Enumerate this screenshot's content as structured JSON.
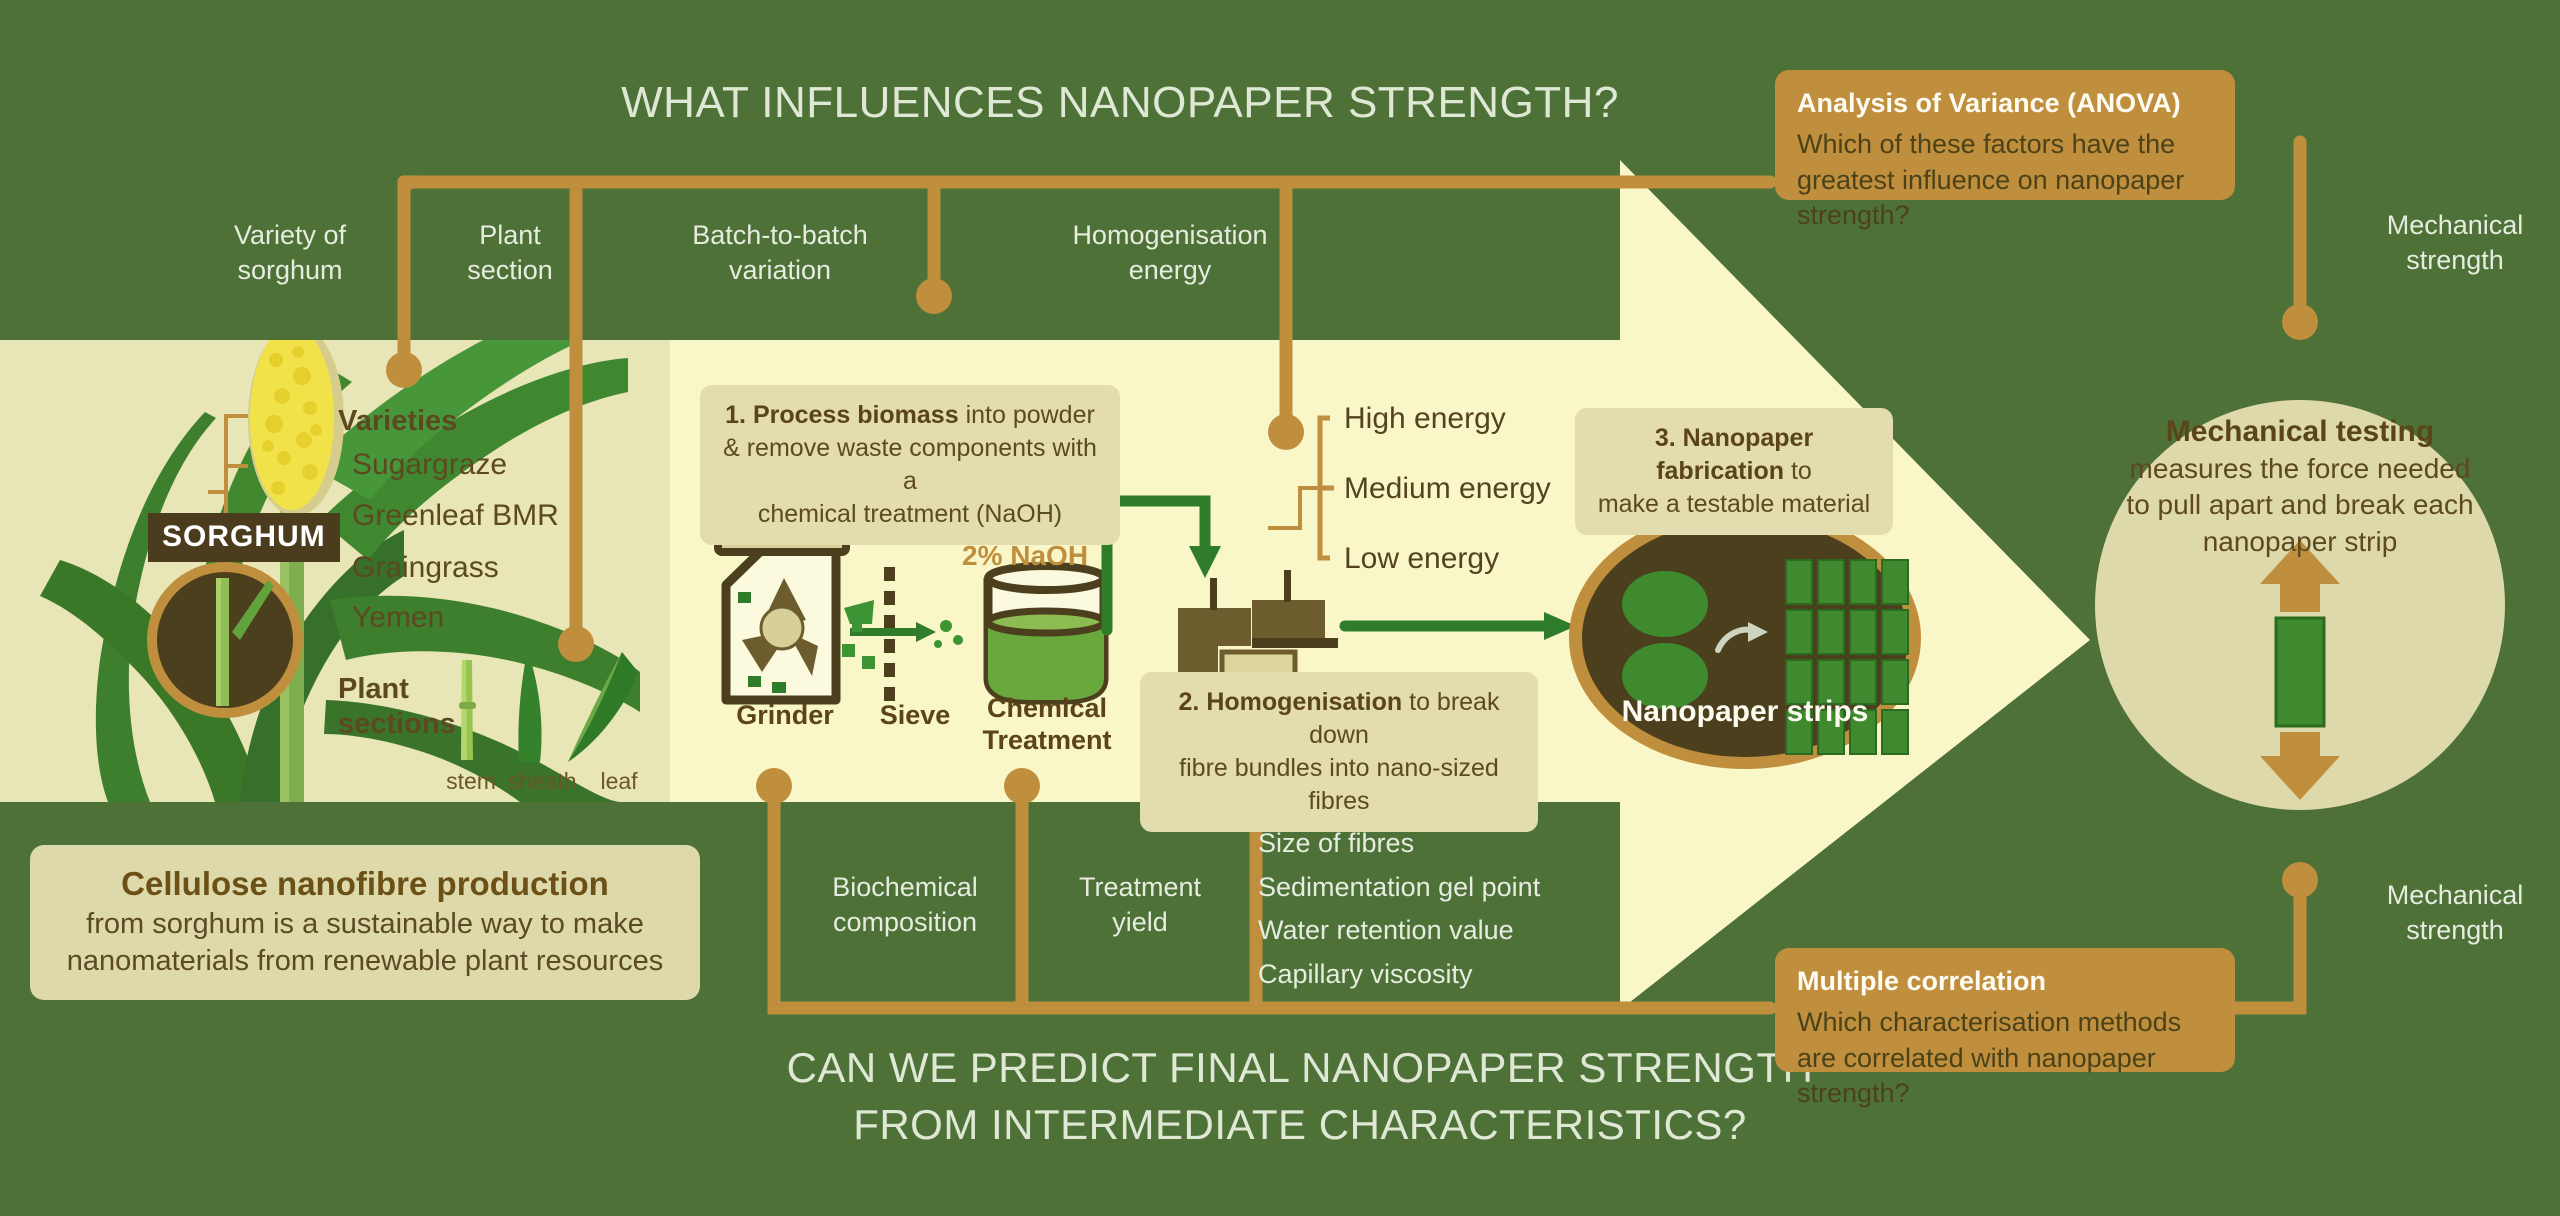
{
  "colors": {
    "bg_green": "#4e7138",
    "panel_cream": "#f7f5c4",
    "panel_khaki": "#e6e3b4",
    "connector": "#c08f3e",
    "card_brown": "#c08f3e",
    "card_khaki": "#ded9ab",
    "text_cream": "#dfe8d4",
    "text_brown": "#5c4920",
    "dark_brown": "#4a3c1c",
    "leaf_green": "#3f8a2e",
    "mid_green": "#2f7d2a"
  },
  "headline": {
    "top": "WHAT INFLUENCES NANOPAPER STRENGTH?",
    "bottom_line1": "CAN WE PREDICT FINAL NANOPAPER STRENGTH",
    "bottom_line2": "FROM INTERMEDIATE CHARACTERISTICS?"
  },
  "top_factors": [
    {
      "line1": "Variety of",
      "line2": "sorghum"
    },
    {
      "line1": "Plant",
      "line2": "section"
    },
    {
      "line1": "Batch-to-batch",
      "line2": "variation"
    },
    {
      "line1": "Homogenisation",
      "line2": "energy"
    }
  ],
  "anova": {
    "title": "Analysis of Variance (ANOVA)",
    "body": "Which of these factors have the greatest influence on nanopaper strength?"
  },
  "correlation": {
    "title": "Multiple correlation",
    "body": "Which characterisation methods are correlated with nanopaper strength?"
  },
  "mechanical_strength_top": {
    "line1": "Mechanical",
    "line2": "strength"
  },
  "mechanical_strength_bottom": {
    "line1": "Mechanical",
    "line2": "strength"
  },
  "summary_card": {
    "title": "Cellulose nanofibre production",
    "line1": "from sorghum is a sustainable way to make",
    "line2": "nanomaterials from renewable plant resources"
  },
  "sorghum_panel": {
    "tag": "SORGHUM",
    "varieties_heading": "Varieties",
    "varieties": [
      "Sugargraze",
      "Greenleaf BMR",
      "Graingrass",
      "Yemen"
    ],
    "sections_heading_line1": "Plant",
    "sections_heading_line2": "sections",
    "sections": [
      "stem",
      "sheath",
      "leaf"
    ]
  },
  "steps": {
    "step1_bold": "1. Process biomass",
    "step1_rest": " into powder",
    "step1_line2": "& remove waste components with a",
    "step1_line3": "chemical treatment (NaOH)",
    "step2_bold": "2. Homogenisation",
    "step2_rest": " to break down",
    "step2_line2": "fibre bundles into nano-sized fibres",
    "step3_bold": "3. Nanopaper fabrication",
    "step3_rest": " to",
    "step3_line2": "make a testable material"
  },
  "process_icons": {
    "grinder": "Grinder",
    "sieve": "Sieve",
    "chemical_line1": "Chemical",
    "chemical_line2": "Treatment",
    "naoh": "2% NaOH"
  },
  "energy_levels": [
    "High energy",
    "Medium energy",
    "Low energy"
  ],
  "nanopaper_label": "Nanopaper strips",
  "mechanical_testing": {
    "title": "Mechanical testing",
    "line1": "measures the force needed",
    "line2": "to pull apart and break each",
    "line3": "nanopaper strip"
  },
  "bottom_factors": [
    {
      "line1": "Biochemical",
      "line2": "composition"
    },
    {
      "line1": "Treatment",
      "line2": "yield"
    }
  ],
  "characterisation_methods": [
    "Size of fibres",
    "Sedimentation gel point",
    "Water retention value",
    "Capillary viscosity"
  ]
}
